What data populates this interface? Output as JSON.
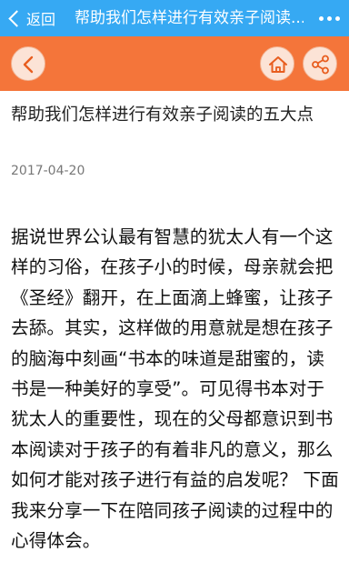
{
  "topbar": {
    "back_label": "返回",
    "title": "帮助我们怎样进行有效亲子阅读..."
  },
  "icons": {
    "back": "chevron-left-icon",
    "nav_back": "chevron-left-icon",
    "home": "home-icon",
    "share": "share-icon",
    "more": "more-dots-icon"
  },
  "colors": {
    "topbar": "#36a9f3",
    "navbar": "#f4753a",
    "nav_button_bg": "#fce3d6",
    "nav_icon": "#e85d1f"
  },
  "article": {
    "title": "帮助我们怎样进行有效亲子阅读的五大点",
    "date": "2017-04-20",
    "body": "据说世界公认最有智慧的犹太人有一个这样的习俗，在孩子小的时候，母亲就会把《圣经》翻开，在上面滴上蜂蜜，让孩子去舔。其实，这样做的用意就是想在孩子的脑海中刻画“书本的味道是甜蜜的，读书是一种美好的享受”。可见得书本对于犹太人的重要性，现在的父母都意识到书本阅读对于孩子的有着非凡的意义，那么如何才能对孩子进行有益的启发呢？ 下面我来分享一下在陪同孩子阅读的过程中的心得体会。"
  }
}
